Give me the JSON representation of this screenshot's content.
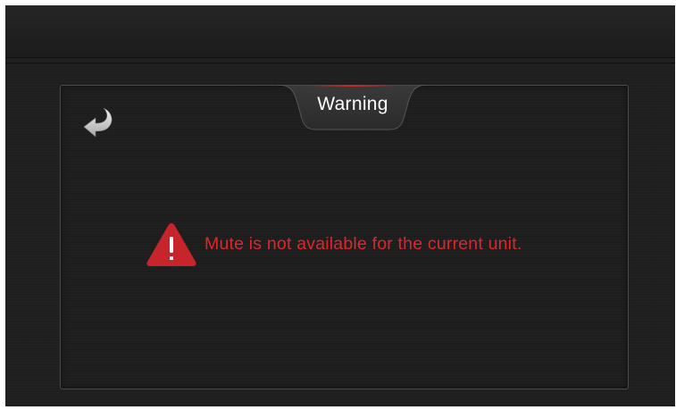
{
  "dialog": {
    "title": "Warning",
    "message": "Mute is not available for the current unit.",
    "back_icon": "back-arrow-icon",
    "warning_icon": "warning-triangle-icon"
  },
  "colors": {
    "message": "#e0262b",
    "warning_icon": "#c7252c",
    "accent_line": "#c62a2a",
    "background": "#1f1f1f"
  }
}
